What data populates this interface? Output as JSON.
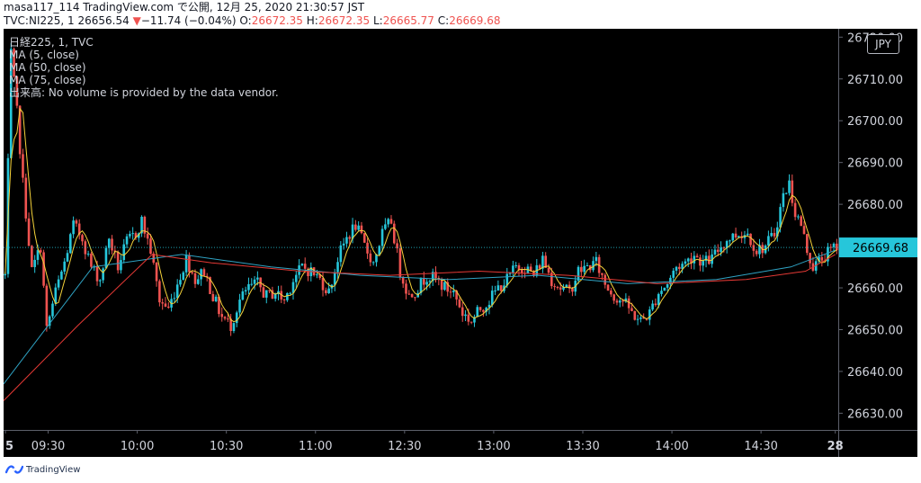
{
  "header": {
    "line1": "masa117_114 TradingView.com で公開, 12月 25, 2020 21:30:57 JST",
    "symbol": "TVC:NI225, 1",
    "last": "26656.54",
    "change_arrow": "▼",
    "change": "−11.74 (−0.04%)",
    "o_label": "O:",
    "o_value": "26672.35",
    "h_label": "H:",
    "h_value": "26672.35",
    "l_label": "L:",
    "l_value": "26665.77",
    "c_label": "C:",
    "c_value": "26669.68"
  },
  "legend": {
    "title": "日経225, 1, TVC",
    "ma5": "MA (5, close)",
    "ma50": "MA (50, close)",
    "ma75": "MA (75, close)",
    "volume_note": "出来高: No volume is provided by the data vendor."
  },
  "currency": "JPY",
  "footer": {
    "brand": "TradingView"
  },
  "colors": {
    "background": "#000000",
    "up": "#26c6da",
    "down": "#ef5350",
    "ma5": "#f5d23a",
    "ma50": "#2fa3c4",
    "ma75": "#e53935",
    "price_tag": "#26c6da"
  },
  "chart_data": {
    "type": "candlestick",
    "title": "日経225, 1, TVC",
    "xlabel": "",
    "ylabel": "",
    "time_ticks": [
      {
        "t": 0,
        "label": "5"
      },
      {
        "t": 15,
        "label": "09:30"
      },
      {
        "t": 45,
        "label": "10:00"
      },
      {
        "t": 75,
        "label": "10:30"
      },
      {
        "t": 105,
        "label": "11:00"
      },
      {
        "t": 135,
        "label": "12:30"
      },
      {
        "t": 165,
        "label": "13:00"
      },
      {
        "t": 195,
        "label": "13:30"
      },
      {
        "t": 225,
        "label": "14:00"
      },
      {
        "t": 255,
        "label": "14:30"
      },
      {
        "t": 280,
        "label": "28"
      }
    ],
    "xlim": [
      0,
      281
    ],
    "ylim": [
      26626,
      26722
    ],
    "price_ticks": [
      26630,
      26640,
      26650,
      26660,
      26670,
      26680,
      26690,
      26700,
      26710,
      26720
    ],
    "price_tick_labels": [
      "26630.00",
      "26640.00",
      "26650.00",
      "26660.00",
      "",
      "26680.00",
      "26690.00",
      "26700.00",
      "26710.00",
      "26720.00"
    ],
    "last_price": 26669.68,
    "last_price_label": "26669.68",
    "close_path": [
      [
        0,
        26663
      ],
      [
        2,
        26716
      ],
      [
        4,
        26702
      ],
      [
        6,
        26685
      ],
      [
        9,
        26664
      ],
      [
        12,
        26670
      ],
      [
        14,
        26650
      ],
      [
        17,
        26659
      ],
      [
        20,
        26666
      ],
      [
        23,
        26675
      ],
      [
        26,
        26672
      ],
      [
        29,
        26665
      ],
      [
        32,
        26662
      ],
      [
        35,
        26672
      ],
      [
        38,
        26665
      ],
      [
        41,
        26671
      ],
      [
        44,
        26673
      ],
      [
        46,
        26676
      ],
      [
        49,
        26669
      ],
      [
        52,
        26657
      ],
      [
        55,
        26655
      ],
      [
        58,
        26661
      ],
      [
        61,
        26667
      ],
      [
        64,
        26662
      ],
      [
        67,
        26664
      ],
      [
        70,
        26658
      ],
      [
        73,
        26653
      ],
      [
        76,
        26651
      ],
      [
        79,
        26657
      ],
      [
        82,
        26660
      ],
      [
        85,
        26661
      ],
      [
        88,
        26658
      ],
      [
        91,
        26659
      ],
      [
        94,
        26657
      ],
      [
        97,
        26662
      ],
      [
        100,
        26665
      ],
      [
        103,
        26664
      ],
      [
        106,
        26662
      ],
      [
        109,
        26659
      ],
      [
        112,
        26667
      ],
      [
        115,
        26672
      ],
      [
        118,
        26675
      ],
      [
        121,
        26670
      ],
      [
        124,
        26666
      ],
      [
        127,
        26673
      ],
      [
        130,
        26676
      ],
      [
        133,
        26664
      ],
      [
        136,
        26658
      ],
      [
        139,
        26660
      ],
      [
        142,
        26663
      ],
      [
        145,
        26662
      ],
      [
        148,
        26660
      ],
      [
        151,
        26659
      ],
      [
        154,
        26654
      ],
      [
        157,
        26652
      ],
      [
        160,
        26655
      ],
      [
        163,
        26657
      ],
      [
        166,
        26660
      ],
      [
        169,
        26662
      ],
      [
        172,
        26665
      ],
      [
        175,
        26665
      ],
      [
        178,
        26663
      ],
      [
        181,
        26667
      ],
      [
        184,
        26662
      ],
      [
        187,
        26660
      ],
      [
        190,
        26659
      ],
      [
        193,
        26664
      ],
      [
        196,
        26665
      ],
      [
        199,
        26666
      ],
      [
        202,
        26661
      ],
      [
        205,
        26658
      ],
      [
        208,
        26657
      ],
      [
        211,
        26654
      ],
      [
        214,
        26652
      ],
      [
        217,
        26654
      ],
      [
        220,
        26659
      ],
      [
        223,
        26661
      ],
      [
        226,
        26665
      ],
      [
        229,
        26666
      ],
      [
        232,
        26668
      ],
      [
        235,
        26666
      ],
      [
        238,
        26667
      ],
      [
        241,
        26670
      ],
      [
        244,
        26672
      ],
      [
        247,
        26673
      ],
      [
        250,
        26673
      ],
      [
        253,
        26669
      ],
      [
        256,
        26670
      ],
      [
        259,
        26673
      ],
      [
        262,
        26682
      ],
      [
        264,
        26685
      ],
      [
        266,
        26678
      ],
      [
        268,
        26675
      ],
      [
        270,
        26669
      ],
      [
        272,
        26665
      ],
      [
        275,
        26667
      ],
      [
        278,
        26669
      ],
      [
        280,
        26670
      ]
    ],
    "series": [
      {
        "name": "MA (5, close)",
        "smoothing": 5
      },
      {
        "name": "MA (50, close)",
        "period": 50,
        "start": [
          0,
          26637
        ],
        "points": [
          [
            30,
            26665
          ],
          [
            60,
            26668
          ],
          [
            90,
            26665
          ],
          [
            120,
            26663
          ],
          [
            150,
            26662
          ],
          [
            180,
            26663
          ],
          [
            210,
            26661
          ],
          [
            240,
            26662
          ],
          [
            265,
            26665
          ],
          [
            280,
            26669
          ]
        ]
      },
      {
        "name": "MA (75, close)",
        "period": 75,
        "start": [
          0,
          26633
        ],
        "points": [
          [
            25,
            26651
          ],
          [
            50,
            26668
          ],
          [
            70,
            26666
          ],
          [
            100,
            26664
          ],
          [
            130,
            26663
          ],
          [
            160,
            26664
          ],
          [
            190,
            26663
          ],
          [
            220,
            26661
          ],
          [
            250,
            26662
          ],
          [
            270,
            26664
          ],
          [
            280,
            26668
          ]
        ]
      }
    ]
  }
}
